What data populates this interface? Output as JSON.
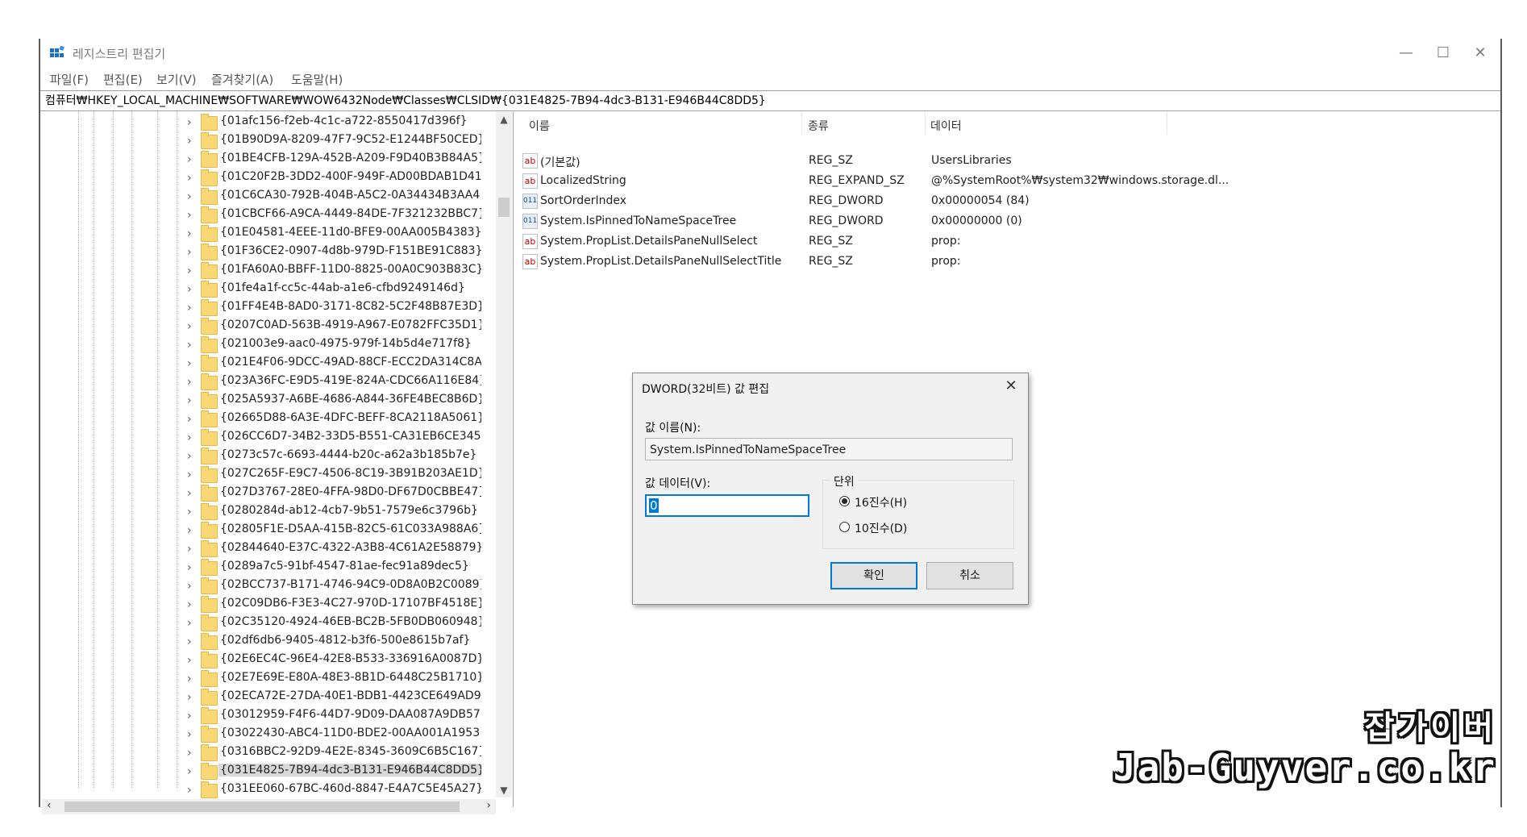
{
  "window": {
    "title": "레지스트리 편집기",
    "minimize": "—",
    "maximize": "☐",
    "close": "✕"
  },
  "menu": [
    "파일(F)",
    "편집(E)",
    "보기(V)",
    "즐겨찾기(A)",
    "도움말(H)"
  ],
  "address": "컴퓨터₩HKEY_LOCAL_MACHINE₩SOFTWARE₩WOW6432Node₩Classes₩CLSID₩{031E4825-7B94-4dc3-B131-E946B44C8DD5}",
  "tree": {
    "items": [
      "{01afc156-f2eb-4c1c-a722-8550417d396f}",
      "{01B90D9A-8209-47F7-9C52-E1244BF50CED}",
      "{01BE4CFB-129A-452B-A209-F9D40B3B84A5}",
      "{01C20F2B-3DD2-400F-949F-AD00BDAB1D41}",
      "{01C6CA30-792B-404B-A5C2-0A34434B3AA4}",
      "{01CBCF66-A9CA-4449-84DE-7F321232BBC7}",
      "{01E04581-4EEE-11d0-BFE9-00AA005B4383}",
      "{01F36CE2-0907-4d8b-979D-F151BE91C883}",
      "{01FA60A0-BBFF-11D0-8825-00A0C903B83C}",
      "{01fe4a1f-cc5c-44ab-a1e6-cfbd9249146d}",
      "{01FF4E4B-8AD0-3171-8C82-5C2F48B87E3D}",
      "{0207C0AD-563B-4919-A967-E0782FFC35D1}",
      "{021003e9-aac0-4975-979f-14b5d4e717f8}",
      "{021E4F06-9DCC-49AD-88CF-ECC2DA314C8A}",
      "{023A36FC-E9D5-419E-824A-CDC66A116E84}",
      "{025A5937-A6BE-4686-A844-36FE4BEC8B6D}",
      "{02665D88-6A3E-4DFC-BEFF-8CA2118A5061}",
      "{026CC6D7-34B2-33D5-B551-CA31EB6CE345}",
      "{0273c57c-6693-4444-b20c-a62a3b185b7e}",
      "{027C265F-E9C7-4506-8C19-3B91B203AE1D}",
      "{027D3767-28E0-4FFA-98D0-DF67D0CBBE47}",
      "{0280284d-ab12-4cb7-9b51-7579e6c3796b}",
      "{02805F1E-D5AA-415B-82C5-61C033A988A6}",
      "{02844640-E37C-4322-A3B8-4C61A2E58879}",
      "{0289a7c5-91bf-4547-81ae-fec91a89dec5}",
      "{02BCC737-B171-4746-94C9-0D8A0B2C0089}",
      "{02C09DB6-F3E3-4C27-970D-17107BF4518E}",
      "{02C35120-4924-46EB-BC2B-5FB0DB060948}",
      "{02df6db6-9405-4812-b3f6-500e8615b7af}",
      "{02E6EC4C-96E4-42E8-B533-336916A0087D}",
      "{02E7E69E-E80A-48E3-8B1D-6448C25B1710}",
      "{02ECA72E-27DA-40E1-BDB1-4423CE649AD9}",
      "{03012959-F4F6-44D7-9D09-DAA087A9DB57}",
      "{03022430-ABC4-11D0-BDE2-00AA001A1953}",
      "{0316BBC2-92D9-4E2E-8345-3609C6B5C167}",
      "{031E4825-7B94-4dc3-B131-E946B44C8DD5}",
      "{031EE060-67BC-460d-8847-E4A7C5E45A27}"
    ],
    "selected_index": 35,
    "chevron": "›"
  },
  "list": {
    "headers": [
      "이름",
      "종류",
      "데이터"
    ],
    "rows": [
      {
        "icon": "ab",
        "name": "(기본값)",
        "type": "REG_SZ",
        "data": "UsersLibraries"
      },
      {
        "icon": "ab",
        "name": "LocalizedString",
        "type": "REG_EXPAND_SZ",
        "data": "@%SystemRoot%₩system32₩windows.storage.dl..."
      },
      {
        "icon": "bin",
        "name": "SortOrderIndex",
        "type": "REG_DWORD",
        "data": "0x00000054 (84)"
      },
      {
        "icon": "bin",
        "name": "System.IsPinnedToNameSpaceTree",
        "type": "REG_DWORD",
        "data": "0x00000000 (0)"
      },
      {
        "icon": "ab",
        "name": "System.PropList.DetailsPaneNullSelect",
        "type": "REG_SZ",
        "data": "prop:"
      },
      {
        "icon": "ab",
        "name": "System.PropList.DetailsPaneNullSelectTitle",
        "type": "REG_SZ",
        "data": "prop:"
      }
    ]
  },
  "dialog": {
    "title": "DWORD(32비트) 값 편집",
    "close": "✕",
    "name_label": "값 이름(N):",
    "name_value": "System.IsPinnedToNameSpaceTree",
    "data_label": "값 데이터(V):",
    "data_value": "0",
    "base_label": "단위",
    "hex_label": "16진수(H)",
    "dec_label": "10진수(D)",
    "selected_base": "hex",
    "ok": "확인",
    "cancel": "취소"
  },
  "watermark": {
    "line1": "잡가이버",
    "line2": "Jab-Guyver.co.kr"
  }
}
